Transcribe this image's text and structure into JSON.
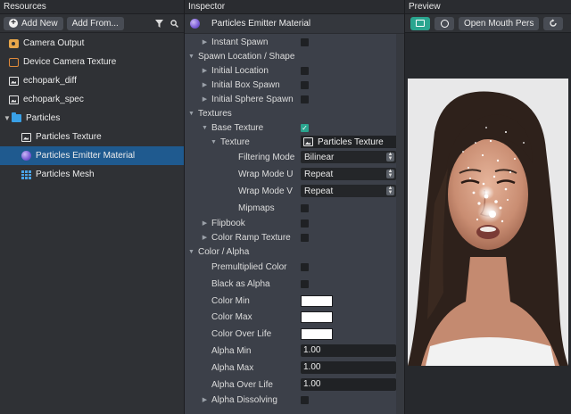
{
  "resources": {
    "title": "Resources",
    "add_new": "Add New",
    "add_from": "Add From...",
    "items": [
      {
        "label": "Camera Output",
        "icon": "camera-output-icon",
        "depth": 1,
        "selected": false
      },
      {
        "label": "Device Camera Texture",
        "icon": "device-camera-icon",
        "depth": 1,
        "selected": false
      },
      {
        "label": "echopark_diff",
        "icon": "image-icon",
        "depth": 1,
        "selected": false
      },
      {
        "label": "echopark_spec",
        "icon": "image-icon",
        "depth": 1,
        "selected": false
      },
      {
        "label": "Particles",
        "icon": "folder-icon",
        "depth": 0,
        "expanded": true,
        "selected": false
      },
      {
        "label": "Particles Texture",
        "icon": "image-icon",
        "depth": 2,
        "selected": false
      },
      {
        "label": "Particles Emitter Material",
        "icon": "material-ball-icon",
        "depth": 2,
        "selected": true
      },
      {
        "label": "Particles Mesh",
        "icon": "mesh-grid-icon",
        "depth": 2,
        "selected": false
      }
    ]
  },
  "inspector": {
    "title": "Inspector",
    "object_name": "Particles Emitter Material",
    "rows": [
      {
        "label": "Instant Spawn",
        "indent": 1,
        "arrow": "collapsed",
        "control": "checkbox",
        "checked": false
      },
      {
        "label": "Spawn Location / Shape",
        "indent": 0,
        "arrow": "expanded",
        "control": "none"
      },
      {
        "label": "Initial Location",
        "indent": 1,
        "arrow": "collapsed",
        "control": "checkbox",
        "checked": false
      },
      {
        "label": "Initial Box Spawn",
        "indent": 1,
        "arrow": "collapsed",
        "control": "checkbox",
        "checked": false
      },
      {
        "label": "Initial Sphere Spawn",
        "indent": 1,
        "arrow": "collapsed",
        "control": "checkbox",
        "checked": false
      },
      {
        "label": "Textures",
        "indent": 0,
        "arrow": "expanded",
        "control": "none"
      },
      {
        "label": "Base Texture",
        "indent": 1,
        "arrow": "expanded",
        "control": "checkbox",
        "checked": true
      },
      {
        "label": "Texture",
        "indent": 2,
        "arrow": "expanded",
        "control": "texture",
        "value": "Particles Texture"
      },
      {
        "label": "Filtering Mode",
        "indent": 3,
        "arrow": "none",
        "control": "select",
        "value": "Bilinear"
      },
      {
        "label": "Wrap Mode U",
        "indent": 3,
        "arrow": "none",
        "control": "select",
        "value": "Repeat"
      },
      {
        "label": "Wrap Mode V",
        "indent": 3,
        "arrow": "none",
        "control": "select",
        "value": "Repeat"
      },
      {
        "label": "Mipmaps",
        "indent": 3,
        "arrow": "none",
        "control": "checkbox",
        "checked": false
      },
      {
        "label": "Flipbook",
        "indent": 1,
        "arrow": "collapsed",
        "control": "checkbox",
        "checked": false
      },
      {
        "label": "Color Ramp Texture",
        "indent": 1,
        "arrow": "collapsed",
        "control": "checkbox",
        "checked": false
      },
      {
        "label": "Color / Alpha",
        "indent": 0,
        "arrow": "expanded",
        "control": "none"
      },
      {
        "label": "Premultiplied Color",
        "indent": 1,
        "arrow": "none",
        "control": "checkbox",
        "checked": false
      },
      {
        "label": "Black as Alpha",
        "indent": 1,
        "arrow": "none",
        "control": "checkbox",
        "checked": false
      },
      {
        "label": "Color Min",
        "indent": 1,
        "arrow": "none",
        "control": "color",
        "value": "#ffffff"
      },
      {
        "label": "Color Max",
        "indent": 1,
        "arrow": "none",
        "control": "color",
        "value": "#ffffff"
      },
      {
        "label": "Color Over Life",
        "indent": 1,
        "arrow": "none",
        "control": "color",
        "value": "#ffffff"
      },
      {
        "label": "Alpha Min",
        "indent": 1,
        "arrow": "none",
        "control": "number",
        "value": "1.00"
      },
      {
        "label": "Alpha Max",
        "indent": 1,
        "arrow": "none",
        "control": "number",
        "value": "1.00"
      },
      {
        "label": "Alpha Over Life",
        "indent": 1,
        "arrow": "none",
        "control": "number",
        "value": "1.00"
      },
      {
        "label": "Alpha Dissolving",
        "indent": 1,
        "arrow": "collapsed",
        "control": "checkbox",
        "checked": false
      }
    ]
  },
  "preview": {
    "title": "Preview",
    "open_button": "Open Mouth Pers"
  },
  "colors": {
    "accent": "#2aa58f",
    "selection": "#1f5a8f",
    "folder": "#39a0e6"
  }
}
